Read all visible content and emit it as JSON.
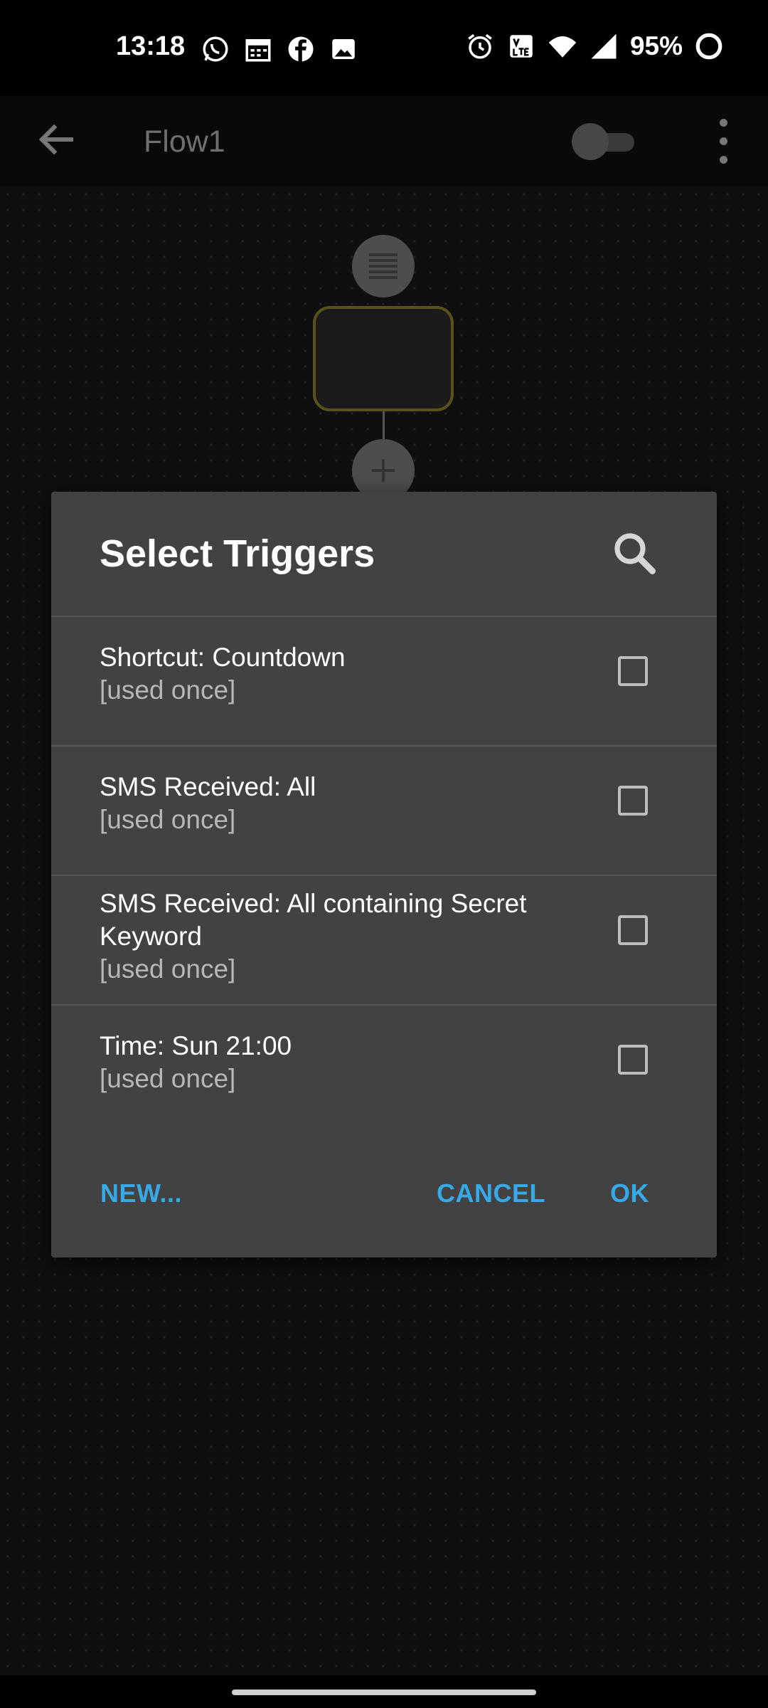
{
  "status_bar": {
    "time": "13:18",
    "battery": "95%",
    "left_icons": [
      "whatsapp-icon",
      "calendar-icon",
      "facebook-icon",
      "image-icon"
    ],
    "right_icons": [
      "alarm-icon",
      "volte-icon",
      "wifi-icon",
      "signal-icon",
      "battery-icon"
    ]
  },
  "app_bar": {
    "title": "Flow1",
    "toggle_on": false
  },
  "dialog": {
    "title": "Select Triggers",
    "items": [
      {
        "title": "Shortcut: Countdown",
        "subtitle": "[used once]",
        "checked": false
      },
      {
        "title": "SMS Received: All",
        "subtitle": "[used once]",
        "checked": false
      },
      {
        "title": "SMS Received: All containing Secret Keyword",
        "subtitle": "[used once]",
        "checked": false
      },
      {
        "title": "Time: Sun 21:00",
        "subtitle": "[used once]",
        "checked": false
      }
    ],
    "buttons": {
      "new": "NEW...",
      "cancel": "CANCEL",
      "ok": "OK"
    }
  },
  "colors": {
    "accent": "#36a9e6",
    "dialog_bg": "#424242",
    "background": "#0f0f0f"
  }
}
